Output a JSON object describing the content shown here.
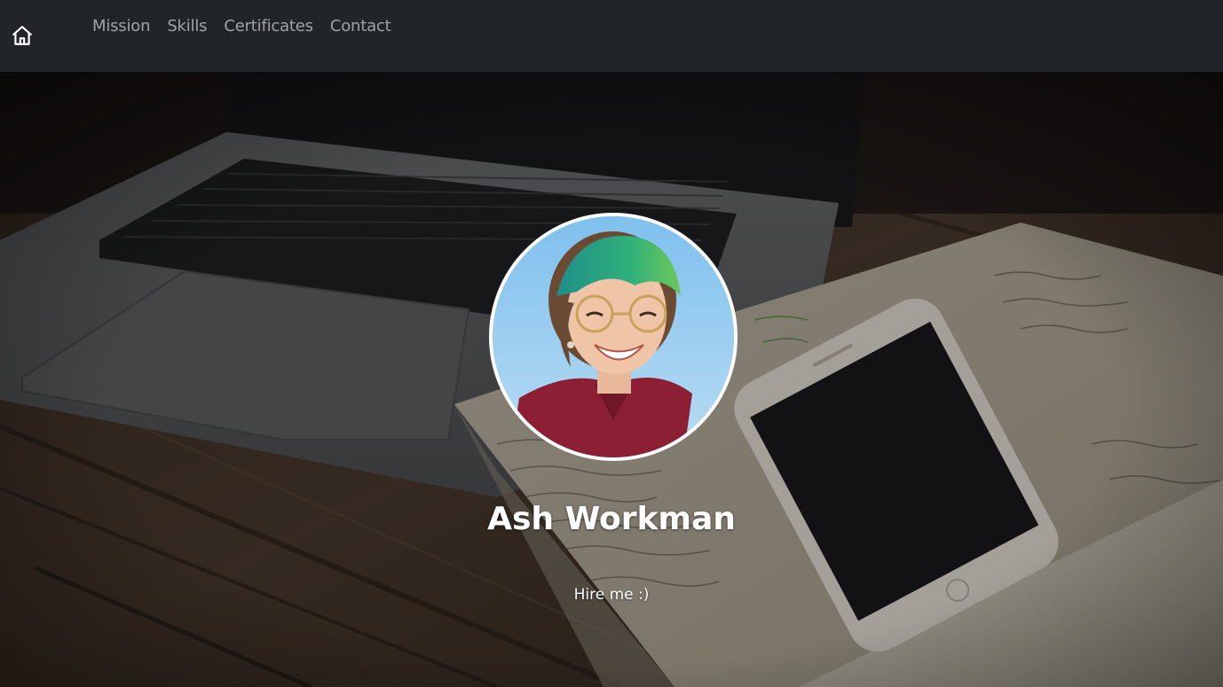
{
  "nav": {
    "home_icon": "house-icon",
    "links": [
      "Mission",
      "Skills",
      "Certificates",
      "Contact"
    ]
  },
  "hero": {
    "name": "Ash Workman",
    "tagline": "Hire me :)"
  },
  "colors": {
    "navbar_bg": "#212529",
    "nav_link": "#a0a3a6",
    "text": "#ffffff",
    "avatar_border": "#ffffff"
  }
}
